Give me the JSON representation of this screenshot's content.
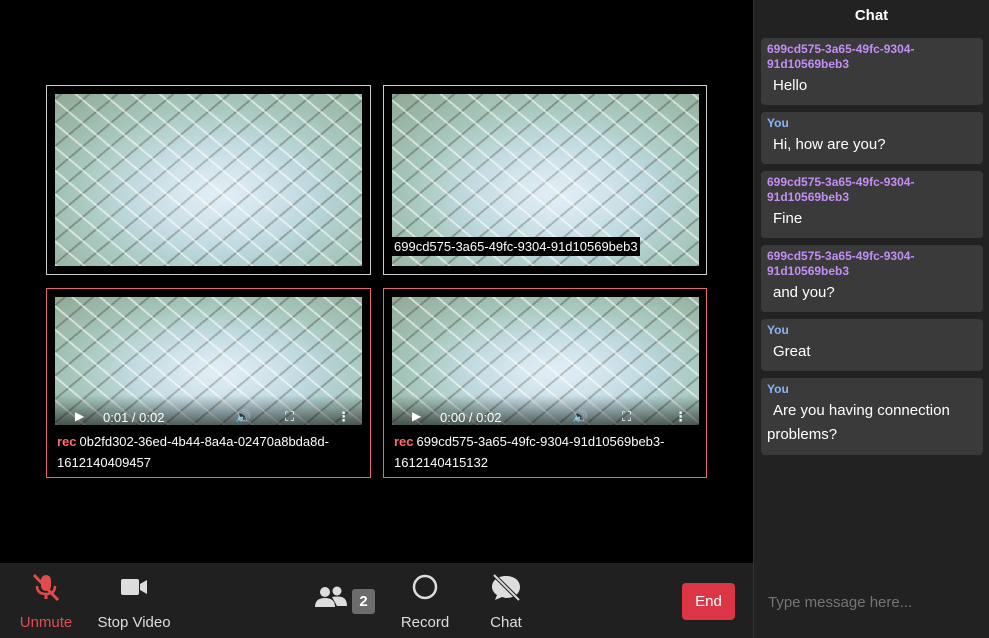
{
  "tiles": [
    {
      "label": ""
    },
    {
      "label": "699cd575-3a65-49fc-9304-91d10569beb3"
    },
    {
      "rec_tag": "rec",
      "name": "0b2fd302-36ed-4b44-8a4a-02470a8bda8d-1612140409457",
      "time": "0:01 / 0:02"
    },
    {
      "rec_tag": "rec",
      "name": "699cd575-3a65-49fc-9304-91d10569beb3-1612140415132",
      "time": "0:00 / 0:02"
    }
  ],
  "chat": {
    "title": "Chat",
    "placeholder": "Type message here...",
    "messages": [
      {
        "sender": "699cd575-3a65-49fc-9304-91d10569beb3",
        "text": "Hello"
      },
      {
        "sender": "You",
        "text": "Hi, how are you?"
      },
      {
        "sender": "699cd575-3a65-49fc-9304-91d10569beb3",
        "text": "Fine"
      },
      {
        "sender": "699cd575-3a65-49fc-9304-91d10569beb3",
        "text": "and you?"
      },
      {
        "sender": "You",
        "text": "Great"
      },
      {
        "sender": "You",
        "text": "Are you having connection problems?"
      }
    ]
  },
  "controls": {
    "unmute": "Unmute",
    "stop_video": "Stop Video",
    "participants_count": "2",
    "record": "Record",
    "chat": "Chat",
    "end": "End"
  },
  "colors": {
    "accent_red": "#dc3545",
    "muted_red": "#e04c4c",
    "other_sender": "#c38ff5",
    "you_sender": "#8ab4f8"
  },
  "icons": [
    "microphone-muted-icon",
    "video-camera-icon",
    "participants-icon",
    "record-icon",
    "chat-hidden-icon",
    "play-icon",
    "volume-icon",
    "fullscreen-icon",
    "more-icon"
  ]
}
